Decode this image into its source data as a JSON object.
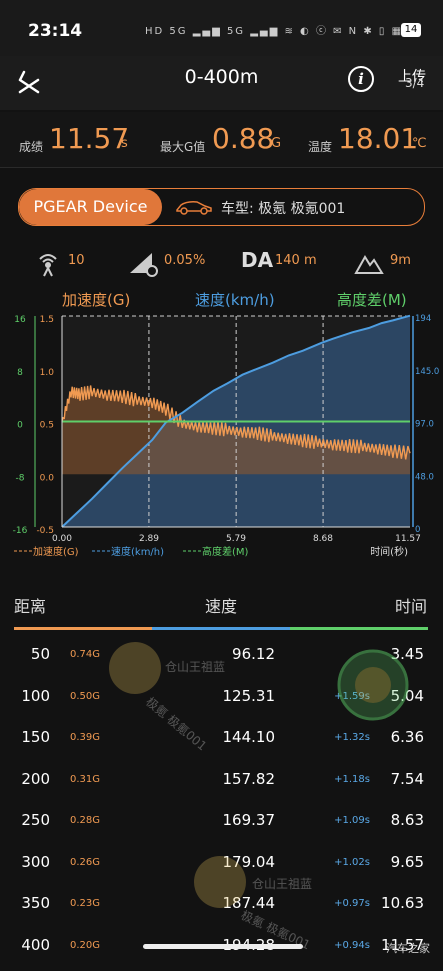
{
  "status": {
    "time": "23:14",
    "icons": "HD 5G ▂▄▆ 5G ▂▄▆ ≋ ◐ ⓒ ✉ N ✱ ▯ ▦ ≋",
    "battery": "14"
  },
  "nav": {
    "title": "0-400m",
    "upload": "上传",
    "page": "3/4"
  },
  "stats": {
    "score_label": "成绩",
    "score": "11.57",
    "score_unit": "s",
    "gmax_label": "最大G值",
    "gmax": "0.88",
    "gmax_unit": "G",
    "temp_label": "温度",
    "temp": "18.01",
    "temp_unit": "℃"
  },
  "device": {
    "name": "PGEAR Device",
    "car": "车型: 极氪 极氪001"
  },
  "metrics": {
    "sat": "10",
    "slope": "0.05%",
    "da_label": "DA",
    "da": "140 m",
    "alt": "9m"
  },
  "chart_data": {
    "type": "line",
    "legend_top": [
      "加速度(G)",
      "速度(km/h)",
      "高度差(M)"
    ],
    "legend_bottom": [
      "加速度(G)",
      "速度(km/h)",
      "高度差(M)"
    ],
    "xlabel": "时间(秒)",
    "x_ticks": [
      "0.00",
      "2.89",
      "5.79",
      "8.68",
      "11.57"
    ],
    "left_alt_ticks": [
      "16",
      "8",
      "0",
      "-8",
      "-16"
    ],
    "left_g_ticks": [
      "1.5",
      "1.0",
      "0.5",
      "0.0",
      "-0.5"
    ],
    "right_speed_ticks": [
      "194",
      "145.0",
      "97.0",
      "48.0",
      "0"
    ],
    "xlim": [
      0,
      11.57
    ],
    "g_lim": [
      -0.5,
      1.5
    ],
    "speed_lim": [
      0,
      194
    ],
    "alt_lim": [
      -16,
      16
    ],
    "colors": {
      "g": "#f09a52",
      "speed": "#4d9de0",
      "alt": "#5fcf6a"
    },
    "series": [
      {
        "name": "速度(km/h)",
        "x": [
          0,
          0.5,
          1,
          1.5,
          2,
          2.5,
          3,
          3.45,
          4,
          4.5,
          5.04,
          5.5,
          6,
          6.36,
          7,
          7.54,
          8,
          8.63,
          9,
          9.65,
          10.2,
          10.63,
          11,
          11.57
        ],
        "values": [
          0,
          13,
          26,
          40,
          54,
          67,
          80,
          96.12,
          105,
          115,
          125.31,
          132,
          140,
          144.1,
          151,
          157.82,
          162,
          169.37,
          173,
          179.04,
          183,
          187.44,
          190,
          194.28
        ]
      },
      {
        "name": "加速度(G)",
        "x": [
          0,
          0.3,
          0.6,
          1,
          1.5,
          2,
          2.5,
          3,
          3.45,
          4,
          4.5,
          5,
          5.5,
          6,
          6.5,
          7,
          7.5,
          8,
          8.5,
          9,
          9.5,
          10,
          10.5,
          11,
          11.57
        ],
        "values": [
          0.5,
          0.78,
          0.76,
          0.78,
          0.75,
          0.74,
          0.7,
          0.68,
          0.62,
          0.48,
          0.45,
          0.44,
          0.42,
          0.4,
          0.39,
          0.36,
          0.34,
          0.32,
          0.3,
          0.28,
          0.27,
          0.26,
          0.24,
          0.22,
          0.2
        ]
      },
      {
        "name": "高度差(M)",
        "x": [
          0,
          11.57
        ],
        "values": [
          0,
          0
        ]
      }
    ]
  },
  "table": {
    "headers": [
      "距离",
      "速度",
      "时间"
    ],
    "rows": [
      {
        "dist": "50",
        "g": "0.74G",
        "speed": "96.12",
        "delta": "",
        "time": "3.45"
      },
      {
        "dist": "100",
        "g": "0.50G",
        "speed": "125.31",
        "delta": "+1.59s",
        "time": "5.04"
      },
      {
        "dist": "150",
        "g": "0.39G",
        "speed": "144.10",
        "delta": "+1.32s",
        "time": "6.36"
      },
      {
        "dist": "200",
        "g": "0.31G",
        "speed": "157.82",
        "delta": "+1.18s",
        "time": "7.54"
      },
      {
        "dist": "250",
        "g": "0.28G",
        "speed": "169.37",
        "delta": "+1.09s",
        "time": "8.63"
      },
      {
        "dist": "300",
        "g": "0.26G",
        "speed": "179.04",
        "delta": "+1.02s",
        "time": "9.65"
      },
      {
        "dist": "350",
        "g": "0.23G",
        "speed": "187.44",
        "delta": "+0.97s",
        "time": "10.63"
      },
      {
        "dist": "400",
        "g": "0.20G",
        "speed": "194.28",
        "delta": "+0.94s",
        "time": "11.57"
      }
    ]
  },
  "watermark": {
    "text1": "仓山王祖蓝",
    "text2": "极氪 极氪001"
  },
  "footer": {
    "logo": "汽车之家"
  }
}
